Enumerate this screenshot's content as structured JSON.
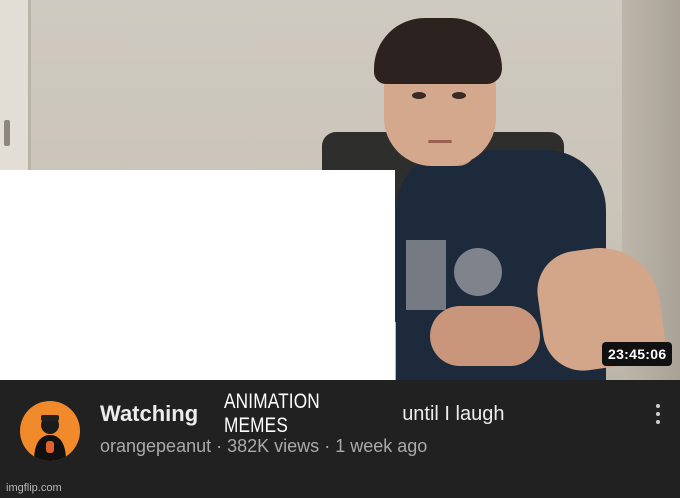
{
  "video": {
    "duration": "23:45:06",
    "title_prefix": "Watching",
    "title_insert": "ANIMATION MEMES",
    "title_suffix": "until I laugh",
    "channel": "orangepeanut",
    "separator": "·",
    "views": "382K views",
    "uploaded": "1 week ago"
  },
  "icons": {
    "menu": "more-vert-icon",
    "avatar": "channel-avatar"
  },
  "colors": {
    "background": "#212121",
    "avatar_bg": "#f08a2a",
    "title": "#ececec",
    "meta": "#aaaaaa"
  },
  "watermark": "imgflip.com"
}
